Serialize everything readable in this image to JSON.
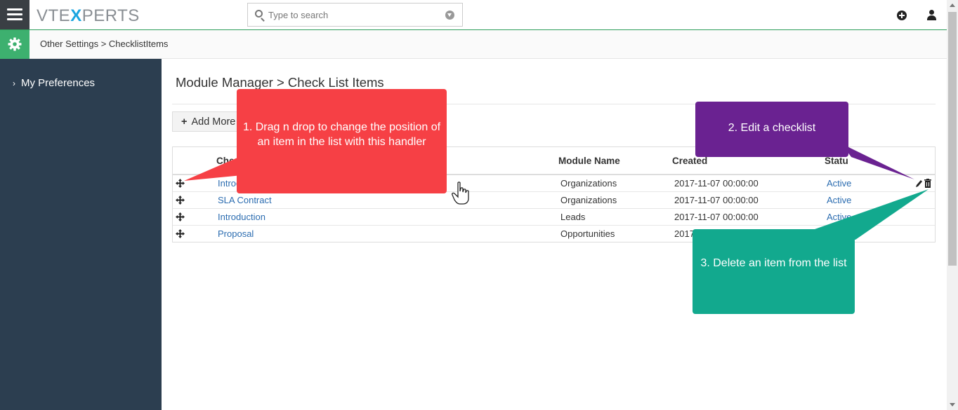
{
  "header": {
    "logo_text_left": "VTE",
    "logo_text_x": "X",
    "logo_text_right": "PERTS",
    "search_placeholder": "Type to search"
  },
  "breadcrumb": "Other Settings > ChecklistItems",
  "sidebar": {
    "items": [
      {
        "label": "My Preferences",
        "icon": "chevron-right-icon"
      }
    ]
  },
  "main": {
    "title": "Module Manager > Check List Items",
    "add_button_label": "Add More",
    "table": {
      "columns": [
        "Checklist Name",
        "Module Name",
        "Created",
        "Status"
      ],
      "visible_column_headers": [
        "Che",
        "Module Name",
        "Created",
        "Statu"
      ],
      "rows": [
        {
          "name": "Introduction",
          "name_visible": "Introd",
          "module": "Organizations",
          "created": "2017-11-07 00:00:00",
          "status": "Active",
          "has_actions": true
        },
        {
          "name": "SLA Contract",
          "name_visible": "SLA Contract",
          "module": "Organizations",
          "created": "2017-11-07 00:00:00",
          "status": "Active",
          "has_actions": false
        },
        {
          "name": "Introduction",
          "name_visible": "Introduction",
          "module": "Leads",
          "created": "2017-11-07 00:00:00",
          "status": "Active",
          "has_actions": false
        },
        {
          "name": "Proposal",
          "name_visible": "Proposal",
          "module": "Opportunities",
          "created": "2017",
          "status": "",
          "has_actions": false
        }
      ]
    }
  },
  "callouts": {
    "drag": {
      "text": "1. Drag n drop to change the position of an item in the list with this handler",
      "color": "#f64045"
    },
    "edit": {
      "text": "2. Edit a checklist",
      "color": "#6a2291"
    },
    "delete": {
      "text": "3. Delete an item from the list",
      "color": "#12a98e"
    }
  },
  "colors": {
    "sidebar": "#2c3e50",
    "accent_green": "#3db06f",
    "link": "#2b6cb0"
  }
}
